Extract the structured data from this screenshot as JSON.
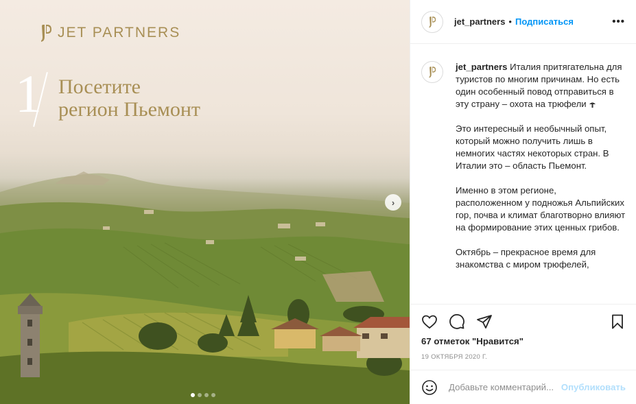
{
  "post": {
    "brand": "JET PARTNERS",
    "slide_number": "1",
    "headline_line1": "Посетите",
    "headline_line2": "регион Пьемонт",
    "carousel": {
      "total": 4,
      "active": 1
    }
  },
  "header": {
    "username": "jet_partners",
    "separator": "•",
    "follow_label": "Подписаться",
    "more_label": "•••"
  },
  "caption": {
    "username": "jet_partners",
    "paragraph1": "Италия притягательна для туристов по многим причинам. Но есть один особенный повод отправиться в эту страну – охота на трюфели",
    "paragraph2": "Это интересный и необычный опыт, который можно получить лишь в немногих частях некоторых стран. В Италии это – область Пьемонт.",
    "paragraph3": "Именно в этом регионе, расположенном у подножья Альпийских гор, почва и климат благотворно влияют на формирование этих ценных грибов.",
    "paragraph4": "Октябрь – прекрасное время для знакомства с миром трюфелей,"
  },
  "actions": {
    "likes": "67 отметок \"Нравится\"",
    "date": "19 ОКТЯБРЯ 2020 Г."
  },
  "comment": {
    "placeholder": "Добавьте комментарий...",
    "post_label": "Опубликовать"
  },
  "colors": {
    "brand_gold": "#a88f55",
    "link_blue": "#0095f6",
    "post_disabled": "#b2dffc"
  }
}
